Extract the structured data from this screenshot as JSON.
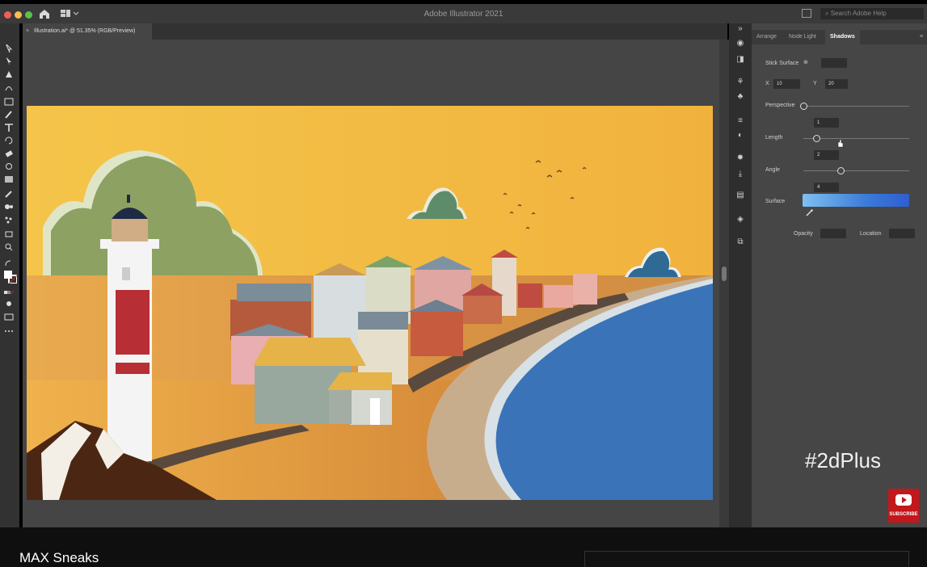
{
  "app": {
    "title": "Adobe Illustrator 2021",
    "search_placeholder": "Search Adobe Help"
  },
  "document": {
    "tab_label": "Illustration.ai* @ 51.35% (RGB/Preview)",
    "close_glyph": "×"
  },
  "panel": {
    "tabs": [
      "Arrange",
      "Node Light",
      "Shadows"
    ],
    "active_tab": "Shadows",
    "stick_surface": {
      "label": "Stick Surface",
      "value": ""
    },
    "x": {
      "label": "X",
      "value": "10"
    },
    "y": {
      "label": "Y",
      "value": "20"
    },
    "perspective": {
      "label": "Perspective",
      "fraction": 0.0
    },
    "length": {
      "label": "Length",
      "field_above": "1",
      "field_below": "2",
      "fraction": 0.12
    },
    "angle": {
      "label": "Angle",
      "field_below": "4",
      "fraction": 0.35
    },
    "surface": {
      "label": "Surface"
    },
    "opacity": {
      "label": "Opacity",
      "value": ""
    },
    "location": {
      "label": "Location",
      "value": ""
    }
  },
  "overlay": {
    "hashtag": "#2dPlus",
    "subscribe_label": "SUBSCRIBE"
  },
  "video": {
    "title": "MAX Sneaks"
  },
  "colors": {
    "sky": "#f2b33c",
    "ground": "#e0a048",
    "sea": "#3a73b8",
    "sand": "#c9b08f",
    "tree": "#8a9e5c",
    "lighthouse_red": "#b72e34",
    "accent_gradient_end": "#2f5ed0"
  }
}
